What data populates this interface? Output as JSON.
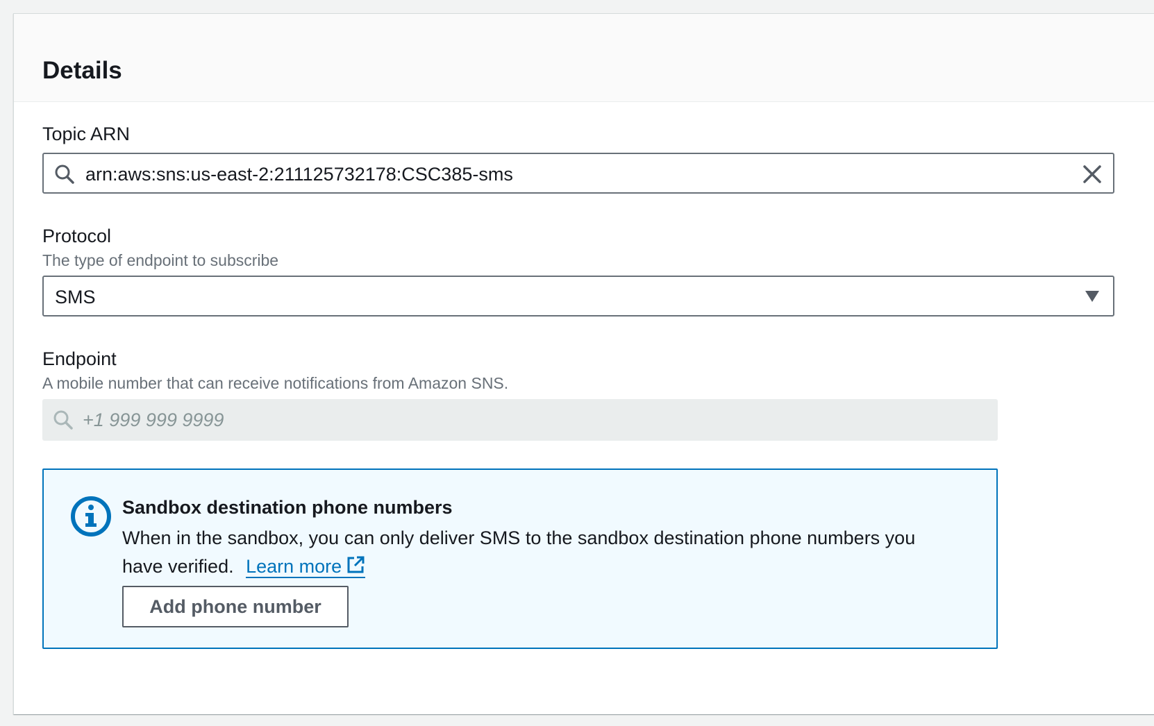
{
  "panel": {
    "title": "Details"
  },
  "topic_arn": {
    "label": "Topic ARN",
    "value": "arn:aws:sns:us-east-2:211125732178:CSC385-sms",
    "search_icon": "search-icon",
    "clear_icon": "close-icon"
  },
  "protocol": {
    "label": "Protocol",
    "description": "The type of endpoint to subscribe",
    "selected": "SMS",
    "caret_icon": "caret-down-icon"
  },
  "endpoint": {
    "label": "Endpoint",
    "description": "A mobile number that can receive notifications from Amazon SNS.",
    "placeholder": "+1 999 999 9999",
    "search_icon": "search-icon"
  },
  "alert": {
    "icon": "info-icon",
    "title": "Sandbox destination phone numbers",
    "body": "When in the sandbox, you can only deliver SMS to the sandbox destination phone numbers you have verified.",
    "link_label": "Learn more",
    "link_icon": "external-link-icon",
    "button_label": "Add phone number",
    "accent_color": "#0073bb"
  }
}
